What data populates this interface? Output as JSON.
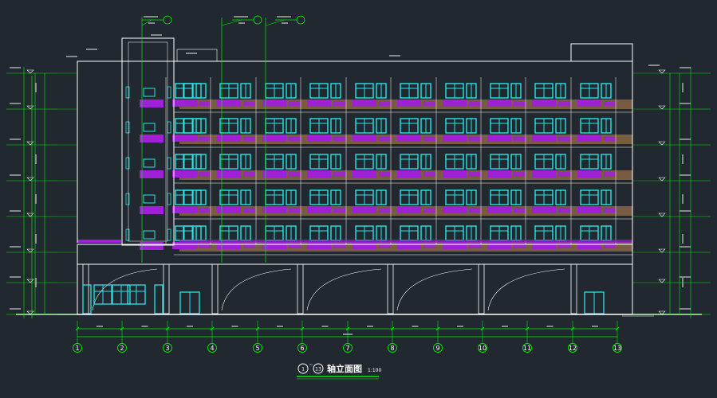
{
  "drawing": {
    "title_start": "1",
    "title_sep": "~",
    "title_end": "13",
    "title_text": "轴立面图",
    "scale": "1:100"
  },
  "axis_labels": [
    "1",
    "2",
    "3",
    "4",
    "5",
    "6",
    "7",
    "8",
    "9",
    "10",
    "11",
    "12",
    "13"
  ],
  "colors": {
    "background": "#212830",
    "outline": "#ffffff",
    "window": "#26e6e6",
    "balcony": "#a020d8",
    "wall_fill": "#7d5f43",
    "dimension": "#00ee00",
    "leader": "#00ee00"
  },
  "icons": [
    "section-callout-icon",
    "elevation-marker-icon",
    "axis-bubble-icon"
  ]
}
